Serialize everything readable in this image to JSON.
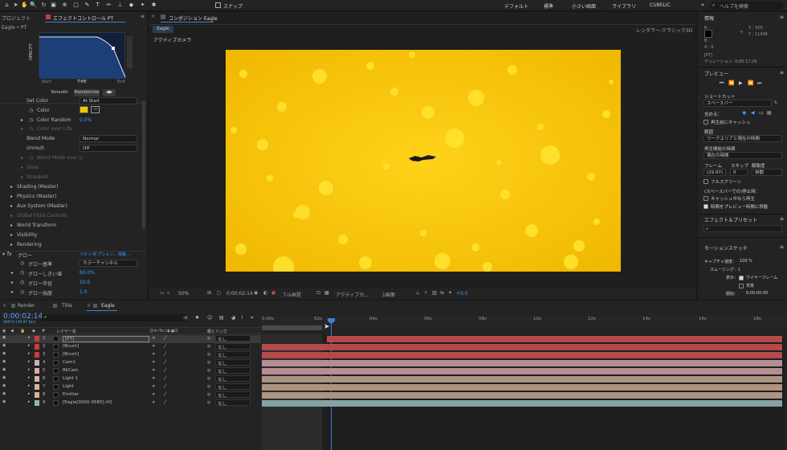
{
  "toolbar": {
    "snap_label": "スナップ",
    "workspaces": [
      "デフォルト",
      "標準",
      "小さい画面",
      "ライブラリ",
      "CUBELIC"
    ],
    "search_placeholder": "ヘルプを検索"
  },
  "left_panel": {
    "tab_project": "プロジェクト",
    "tab_effect": "エフェクトコントロール PT",
    "layer_title": "Eagle • PT",
    "graph": {
      "y_label": "OPACITY",
      "x_start": "Start",
      "x_mid": "TIME",
      "x_end": "End",
      "smooth": "Smooth",
      "randomize": "Randomize"
    },
    "props": {
      "set_color": "Set Color",
      "set_color_value": "At Start",
      "color": "Color",
      "color_random": "Color Random",
      "color_random_value": "0.0%",
      "color_over_life": "Color over Life",
      "blend_mode": "Blend Mode",
      "blend_mode_value": "Normal",
      "unmult": "Unmult",
      "unmult_value": "Off",
      "blend_mode_over": "Blend Mode over Li",
      "glow": "Glow",
      "streaklet": "Streaklet",
      "shading": "Shading (Master)",
      "physics": "Physics (Master)",
      "aux": "Aux System (Master)",
      "global_fluid": "Global Fluid Controls",
      "world_transform": "World Transform",
      "visibility": "Visibility",
      "rendering": "Rendering"
    },
    "glow": {
      "title": "グロー",
      "reset": "リセット",
      "options": "オプション...",
      "about": "情報...",
      "base": "グロー基準",
      "base_value": "カラーチャンネル",
      "threshold": "グローしきい値",
      "threshold_value": "60.0%",
      "radius": "グロー半径",
      "radius_value": "10.0",
      "intensity": "グロー強度",
      "intensity_value": "1.0"
    }
  },
  "comp_panel": {
    "tab": "コンポジション Eagle",
    "comp_tab": "Eagle",
    "renderer_label": "レンダラー:",
    "renderer_value": "クラシック3D",
    "camera_label": "アクティブカメラ",
    "footer": {
      "zoom": "50%",
      "time": "0:00:02:14",
      "quality": "フル画質",
      "camera": "アクティブカ...",
      "views": "1画面",
      "offset": "+0.0"
    }
  },
  "right_panel": {
    "info": {
      "title": "情報",
      "r": "R :",
      "g": "G :",
      "b": "B :",
      "a": "A : 0",
      "x": "X : 500",
      "y": "Y : 11436",
      "pt": "[PT]",
      "duration": "デュレーション: 0:00:17:29"
    },
    "preview": {
      "title": "プレビュー"
    },
    "shortcut": {
      "title": "ショートカット",
      "value": "スペースバー"
    },
    "include_label": "含める：",
    "cache_before": "再生前にキャッシュ",
    "range_label": "範囲",
    "range_value": "ワークエリアと現在の時間",
    "play_from_label": "再生開始の時間",
    "play_from_value": "現在の時間",
    "frame_labels": [
      "フレーム",
      "スキップ",
      "解像度"
    ],
    "frame_values": [
      "(29.97)",
      "0",
      "自動"
    ],
    "fullscreen": "フルスクリーン",
    "stop_label": "(スペースバーでの)停止時：",
    "cache_play": "キャッシュ中なら再生",
    "move_time": "時間をプレビュー時間に移動",
    "effects_presets": "エフェクト＆プリセット",
    "motion_sketch": {
      "title": "モーションスケッチ",
      "capture": "キャプチャ速度：",
      "capture_value": "100 %",
      "smooth": "スムージング：1",
      "show": "表示：",
      "wireframe": "ワイヤーフレーム",
      "bg": "背景",
      "start": "開始：",
      "start_value": "0:00:00:00"
    }
  },
  "timeline": {
    "tabs": [
      "Render",
      "Title",
      "Eagle"
    ],
    "timecode": "0:00:02:14",
    "frames": "00074 (29.97 fps)",
    "col_layer": "レイヤー名",
    "col_parent": "親とリンク",
    "ruler": [
      "0:00s",
      "02s",
      "04s",
      "06s",
      "08s",
      "10s",
      "12s",
      "14s",
      "16s",
      "18s"
    ],
    "layers": [
      {
        "num": "1",
        "name": "[PT]",
        "color": "#c83c3c",
        "parent": "なし",
        "bar": "#b44a4a",
        "bar_start": 0.245
      },
      {
        "num": "2",
        "name": "[Brush]",
        "color": "#c83c3c",
        "parent": "なし",
        "bar": "#b44a4a",
        "bar_start": 0
      },
      {
        "num": "3",
        "name": "[Brush]",
        "color": "#c83c3c",
        "parent": "なし",
        "bar": "#b44a4a",
        "bar_start": 0
      },
      {
        "num": "4",
        "name": "Cam1",
        "color": "#d9a8b0",
        "parent": "なし",
        "bar": "#b58d93",
        "bar_start": 0
      },
      {
        "num": "5",
        "name": "BkCam",
        "color": "#d9a8b0",
        "parent": "なし",
        "bar": "#b58d93",
        "bar_start": 0
      },
      {
        "num": "6",
        "name": "Light 1",
        "color": "#d8b49a",
        "parent": "なし",
        "bar": "#ad9380",
        "bar_start": 0
      },
      {
        "num": "7",
        "name": "Light",
        "color": "#d8b49a",
        "parent": "なし",
        "bar": "#ad9380",
        "bar_start": 0
      },
      {
        "num": "8",
        "name": "Emitter",
        "color": "#d8b49a",
        "parent": "なし",
        "bar": "#ad9380",
        "bar_start": 0
      },
      {
        "num": "9",
        "name": "[Eagle[0000-0580].tif]",
        "color": "#8fb9b9",
        "parent": "なし",
        "bar": "#86a3a3",
        "bar_start": 0
      }
    ]
  }
}
